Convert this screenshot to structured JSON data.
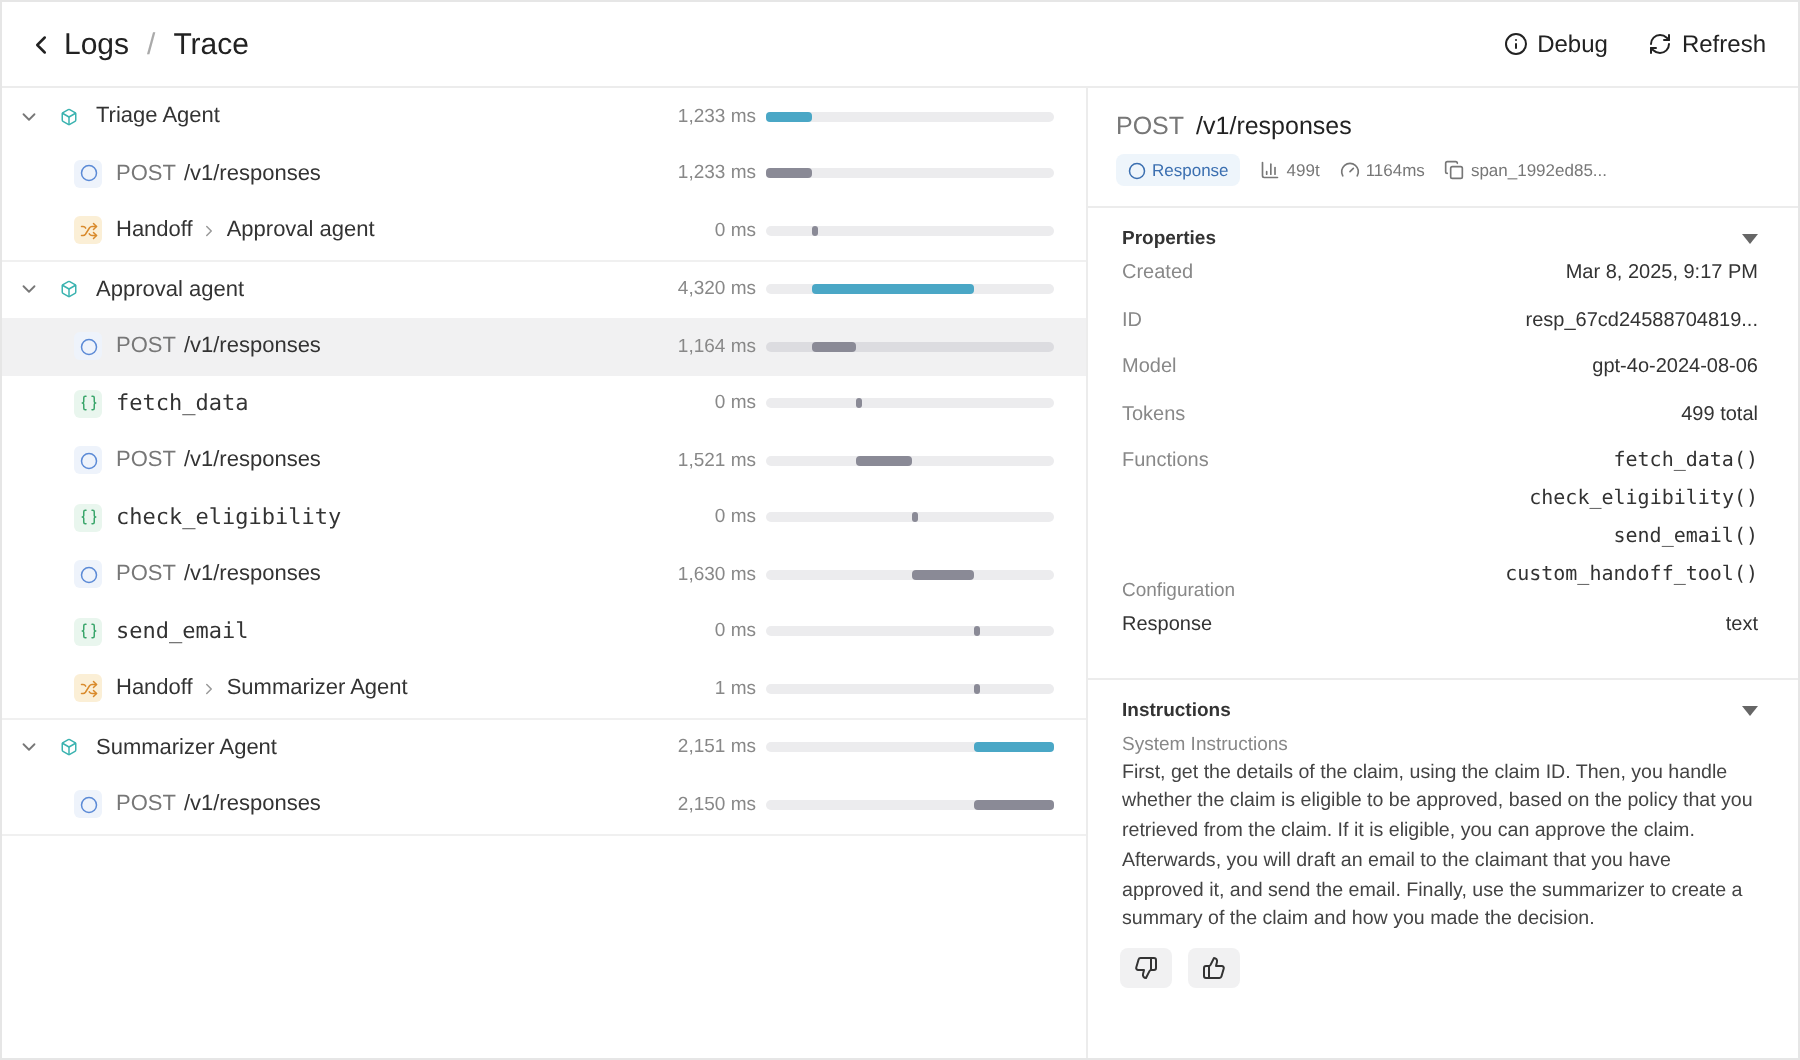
{
  "breadcrumb": {
    "back": "Logs",
    "separator": "/",
    "current": "Trace"
  },
  "actions": [
    {
      "kind": "debug",
      "label": "Debug"
    },
    {
      "kind": "refresh",
      "label": "Refresh"
    }
  ],
  "trace": [
    {
      "kind": "agent",
      "label": "Triage Agent",
      "expanded": true,
      "selected": false,
      "duration": "1,233 ms",
      "children": [
        {
          "kind": "response",
          "method": "POST",
          "label": "/v1/responses",
          "selected": false,
          "duration": "1,233 ms"
        },
        {
          "kind": "handoff",
          "label": "Handoff",
          "target": "Approval agent",
          "selected": false,
          "duration": "0 ms"
        }
      ]
    },
    {
      "kind": "agent",
      "label": "Approval agent",
      "expanded": true,
      "selected": false,
      "duration": "4,320 ms",
      "children": [
        {
          "kind": "response",
          "method": "POST",
          "label": "/v1/responses",
          "selected": true,
          "duration": "1,164 ms"
        },
        {
          "kind": "function",
          "label": "fetch_data",
          "selected": false,
          "duration": "0 ms"
        },
        {
          "kind": "response",
          "method": "POST",
          "label": "/v1/responses",
          "selected": false,
          "duration": "1,521 ms"
        },
        {
          "kind": "function",
          "label": "check_eligibility",
          "selected": false,
          "duration": "0 ms"
        },
        {
          "kind": "response",
          "method": "POST",
          "label": "/v1/responses",
          "selected": false,
          "duration": "1,630 ms"
        },
        {
          "kind": "function",
          "label": "send_email",
          "selected": false,
          "duration": "0 ms"
        },
        {
          "kind": "handoff",
          "label": "Handoff",
          "target": "Summarizer Agent",
          "selected": false,
          "duration": "1 ms"
        }
      ]
    },
    {
      "kind": "agent",
      "label": "Summarizer Agent",
      "expanded": true,
      "selected": false,
      "duration": "2,151 ms",
      "children": [
        {
          "kind": "response",
          "method": "POST",
          "label": "/v1/responses",
          "selected": false,
          "duration": "2,150 ms"
        }
      ]
    }
  ],
  "detail": {
    "method": "POST",
    "path": "/v1/responses",
    "meta": [
      {
        "kind": "badge",
        "label": "Response"
      },
      {
        "kind": "tokens",
        "label": "499t"
      },
      {
        "kind": "time",
        "label": "1164ms"
      },
      {
        "kind": "copy",
        "label": "span_1992ed85..."
      }
    ],
    "properties": {
      "title": "Properties",
      "expanded": true,
      "rows": [
        {
          "label": "Created",
          "values": [
            "Mar 8, 2025, 9:17 PM"
          ],
          "mono": false
        },
        {
          "label": "ID",
          "values": [
            "resp_67cd24588704819..."
          ],
          "mono": false
        },
        {
          "label": "Model",
          "values": [
            "gpt-4o-2024-08-06"
          ],
          "mono": false
        },
        {
          "label": "Tokens",
          "values": [
            "499 total"
          ],
          "mono": false
        },
        {
          "label": "Functions",
          "values": [
            "fetch_data()",
            "check_eligibility()",
            "send_email()",
            "custom_handoff_tool()"
          ],
          "mono": true
        }
      ],
      "subheading": "Configuration",
      "config": [
        {
          "label": "Response",
          "values": [
            "text"
          ],
          "mono": false
        }
      ]
    },
    "instructions": {
      "title": "Instructions",
      "expanded": true,
      "label": "System Instructions",
      "text": "First, get the details of the claim, using the claim ID. Then, you handle whether the claim is eligible to be approved, based on the policy that you retrieved from the claim. If it is eligible, you can approve the claim. Afterwards, you will draft an email to the claimant that you have approved it, and send the email. Finally, use the summarizer to create a summary of the claim and how you made the decision."
    },
    "feedback": [
      {
        "kind": "down"
      },
      {
        "kind": "up"
      }
    ]
  }
}
